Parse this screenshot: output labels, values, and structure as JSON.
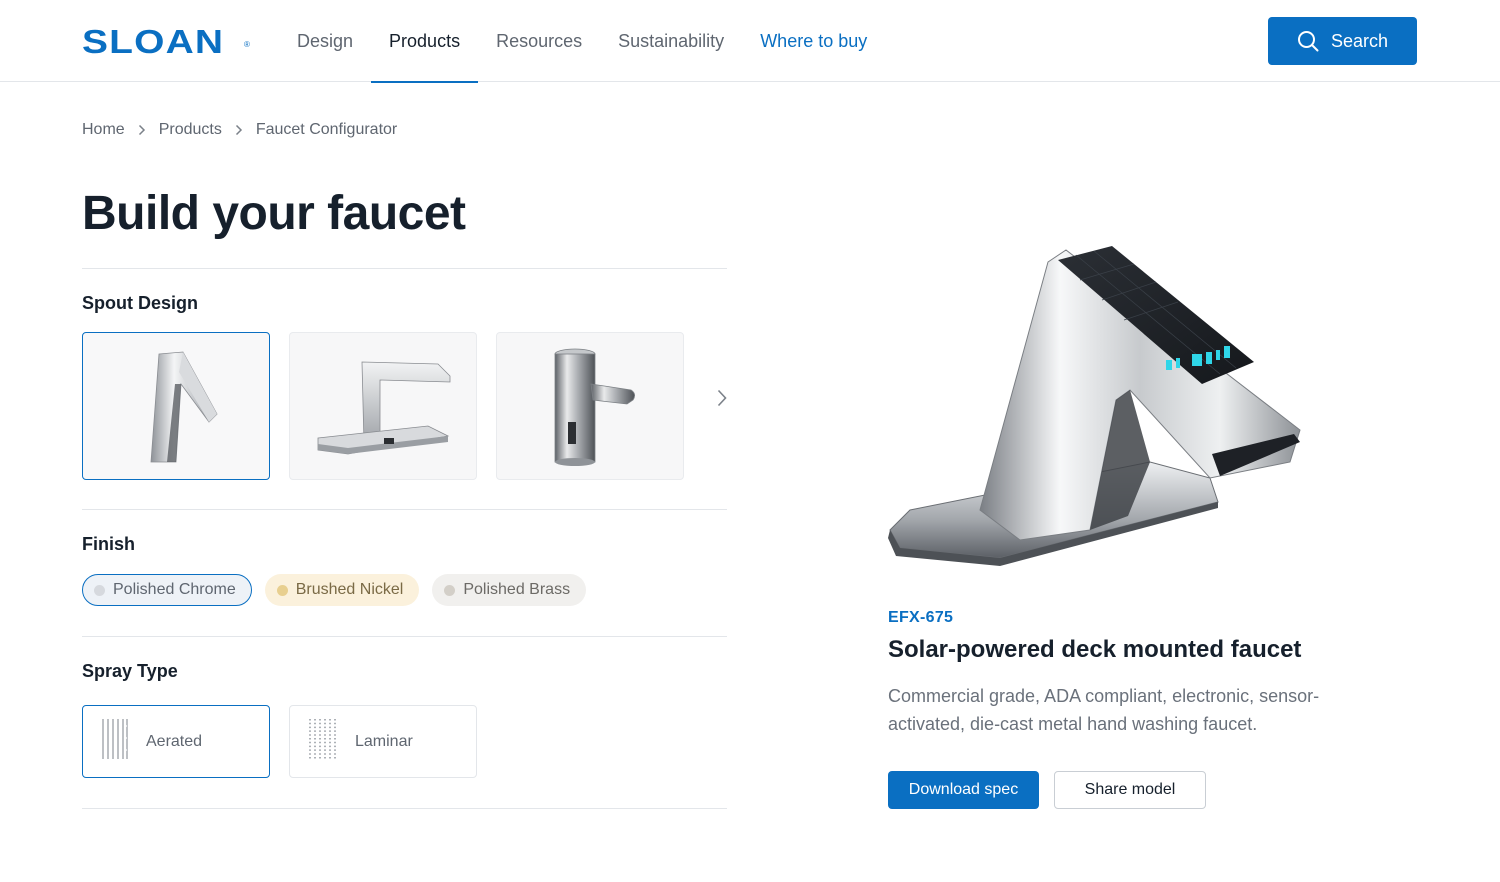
{
  "brand": {
    "logo_text": "SLOAN",
    "logo_mark": "®",
    "accent_color": "#0a6fc2"
  },
  "nav": {
    "items": [
      {
        "label": "Design"
      },
      {
        "label": "Products"
      },
      {
        "label": "Resources"
      },
      {
        "label": "Sustainability"
      },
      {
        "label": "Where to buy"
      }
    ],
    "active": "Products"
  },
  "search": {
    "label": "Search",
    "icon": "search-icon"
  },
  "breadcrumb": [
    "Home",
    "Products",
    "Faucet Configurator"
  ],
  "page_title": "Build your faucet",
  "spout": {
    "title": "Spout Design",
    "options": [
      "angled-spout-faucet",
      "bridge-spout-faucet-with-deck-plate",
      "cylindrical-spout-faucet"
    ],
    "selected_index": 0,
    "next_icon": "chevron-right-icon"
  },
  "finish": {
    "title": "Finish",
    "options": [
      {
        "label": "Polished Chrome",
        "color": "#d6d9de"
      },
      {
        "label": "Brushed Nickel",
        "color": "#e8cf8f"
      },
      {
        "label": "Polished Brass",
        "color": "#d3cfc8"
      }
    ],
    "selected": "Polished Chrome"
  },
  "spray": {
    "title": "Spray Type",
    "options": [
      {
        "label": "Aerated",
        "icon": "aerated-spray-icon"
      },
      {
        "label": "Laminar",
        "icon": "laminar-spray-icon"
      }
    ],
    "selected": "Aerated"
  },
  "product": {
    "code": "EFX-675",
    "name": "Solar-powered deck mounted faucet",
    "description": "Commercial grade, ADA compliant, electronic, sensor-activated, die-cast metal hand washing faucet.",
    "primary_action": "Download spec",
    "secondary_action": "Share model"
  }
}
